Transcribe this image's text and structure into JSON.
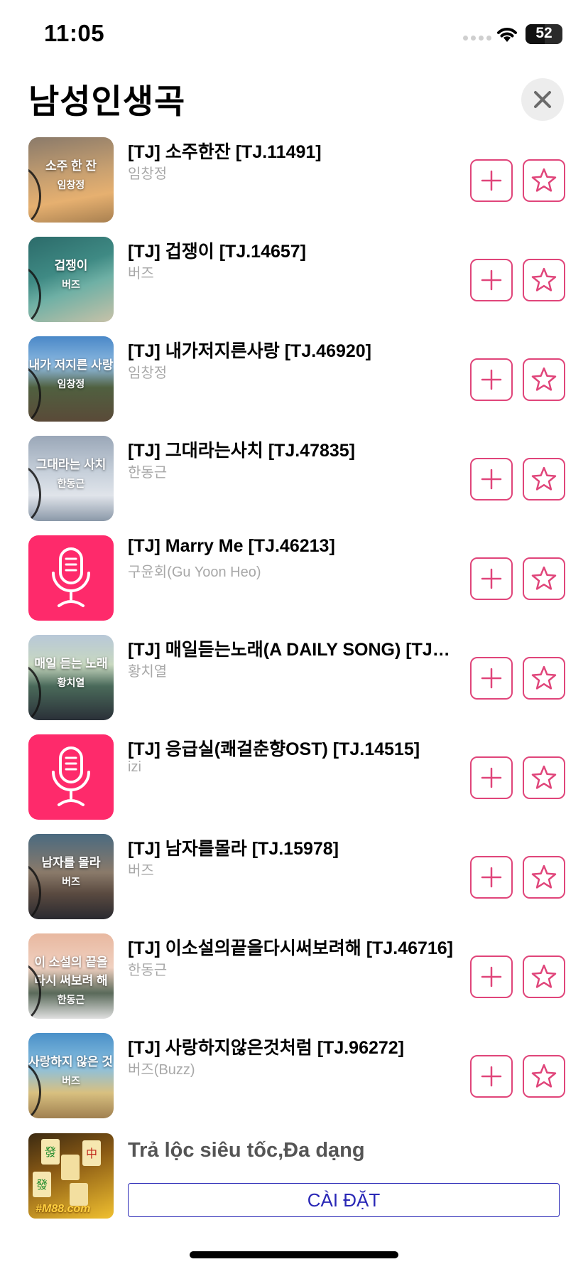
{
  "status": {
    "time": "11:05",
    "battery": "52"
  },
  "header": {
    "title": "남성인생곡"
  },
  "songs": [
    {
      "title": "[TJ] 소주한잔 [TJ.11491]",
      "artist": "임창정",
      "cover": "photo",
      "cap1": "소주 한 잔",
      "cap2": "임창정"
    },
    {
      "title": "[TJ] 겁쟁이 [TJ.14657]",
      "artist": "버즈",
      "cover": "photo",
      "cap1": "겁쟁이",
      "cap2": "버즈"
    },
    {
      "title": "[TJ] 내가저지른사랑 [TJ.46920]",
      "artist": "임창정",
      "cover": "photo",
      "cap1": "내가 저지른 사랑",
      "cap2": "임창정"
    },
    {
      "title": "[TJ] 그대라는사치 [TJ.47835]",
      "artist": "한동근",
      "cover": "photo",
      "cap1": "그대라는 사치",
      "cap2": "한동근"
    },
    {
      "title": "[TJ] Marry Me [TJ.46213]",
      "artist": "구윤회(Gu Yoon Heo)",
      "cover": "mic",
      "cap1": "",
      "cap2": ""
    },
    {
      "title": "[TJ] 매일듣는노래(A DAILY SONG) [TJ.…",
      "artist": "황치열",
      "cover": "photo",
      "cap1": "매일 듣는 노래",
      "cap2": "황치열"
    },
    {
      "title": "[TJ] 응급실(쾌걸춘향OST) [TJ.14515]",
      "artist": "izi",
      "cover": "mic",
      "cap1": "",
      "cap2": ""
    },
    {
      "title": "[TJ] 남자를몰라 [TJ.15978]",
      "artist": "버즈",
      "cover": "photo",
      "cap1": "남자를 몰라",
      "cap2": "버즈"
    },
    {
      "title": "[TJ] 이소설의끝을다시써보려해 [TJ.46716]",
      "artist": "한동근",
      "cover": "photo",
      "cap1": "이 소설의 끝을\n다시 써보려 해",
      "cap2": "한동근"
    },
    {
      "title": "[TJ] 사랑하지않은것처럼 [TJ.96272]",
      "artist": "버즈(Buzz)",
      "cover": "photo",
      "cap1": "사랑하지 않은 것 처럼",
      "cap2": "버즈"
    }
  ],
  "cover_gradients": [
    "linear-gradient(170deg,#8a7a6a 0%,#c8a070 45%,#e6b070 70%,#a88050 100%)",
    "linear-gradient(160deg,#2c6b6a 0%,#3f8a84 40%,#6fb0a5 60%,#c8c2a8 100%)",
    "linear-gradient(180deg,#4a88c8 0%,#8fbbe0 35%,#506040 60%,#5a4a38 100%)",
    "linear-gradient(180deg,#9aa7b8 0%,#c9d2dc 45%,#e0e4ea 70%,#8a98a8 100%)",
    "linear-gradient(180deg,#fe2a6b 0%,#fe2a6b 100%)",
    "linear-gradient(180deg,#b8c8d8 0%,#c8d8c0 35%,#4a6a5a 60%,#2a3038 100%)",
    "linear-gradient(180deg,#fe2a6b 0%,#fe2a6b 100%)",
    "linear-gradient(180deg,#4a6a80 0%,#8a7a6a 45%,#5a4a40 70%,#2a2a30 100%)",
    "linear-gradient(180deg,#e8b8a0 0%,#f0d0c0 40%,#5a6a5a 70%,#e0e0e0 100%)",
    "linear-gradient(180deg,#4a90c8 0%,#8ac0e0 40%,#d8c080 70%,#a08050 100%)"
  ],
  "ad": {
    "title": "Trả lộc siêu tốc,Đa dạng",
    "button": "CÀI ĐẶT",
    "brand": "#M88.com"
  },
  "colors": {
    "accent": "#e0457a",
    "mic_bg": "#fe2a6b",
    "ad_link": "#2a28b6"
  }
}
